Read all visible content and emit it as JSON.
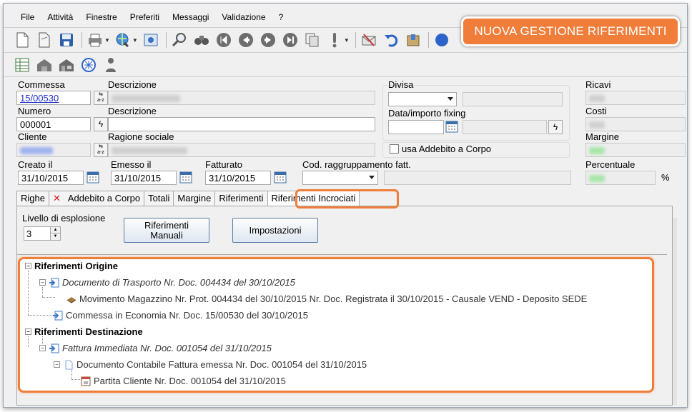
{
  "menu": [
    "File",
    "Attività",
    "Finestre",
    "Preferiti",
    "Messaggi",
    "Validazione",
    "?"
  ],
  "banner": "NUOVA GESTIONE RIFERIMENTI",
  "form": {
    "commessa_label": "Commessa",
    "commessa_value": "15/00530",
    "descrizione_label": "Descrizione",
    "numero_label": "Numero",
    "numero_value": "000001",
    "descrizione2_label": "Descrizione",
    "cliente_label": "Cliente",
    "ragione_sociale_label": "Ragione sociale",
    "divisa_label": "Divisa",
    "fixing_label": "Data/importo fixing",
    "addebito_label": "usa Addebito a Corpo",
    "ricavi_label": "Ricavi",
    "costi_label": "Costi",
    "margine_label": "Margine",
    "percentuale_label": "Percentuale",
    "percent_sign": "%",
    "creato_label": "Creato il",
    "creato_value": "31/10/2015",
    "emesso_label": "Emesso il",
    "emesso_value": "31/10/2015",
    "fatturato_label": "Fatturato",
    "fatturato_value": "31/10/2015",
    "cod_label": "Cod. raggruppamento fatt.",
    "lookup_icon_text": "a-z"
  },
  "tabs": [
    "Righe",
    "Addebito a Corpo",
    "Totali",
    "Margine",
    "Riferimenti",
    "Riferimenti Incrociati"
  ],
  "panel": {
    "livello_label": "Livello di esplosione",
    "livello_value": "3",
    "btn_manuali": "Riferimenti\nManuali",
    "btn_impostazioni": "Impostazioni"
  },
  "tree": {
    "origine": "Riferimenti Origine",
    "ddt": "Documento di Trasporto Nr. Doc. 004434 del 30/10/2015",
    "movimento": "Movimento Magazzino Nr. Prot. 004434 del 30/10/2015 Nr. Doc.  Registrata il 30/10/2015  - Causale VEND - Deposito SEDE",
    "commessa": "Commessa in Economia Nr. Doc. 15/00530 del 30/10/2015",
    "destinazione": "Riferimenti Destinazione",
    "fattura": "Fattura Immediata Nr. Doc. 001054 del 31/10/2015",
    "contabile": "Documento Contabile Fattura emessa Nr. Doc. 001054 del 31/10/2015",
    "partita": "Partita Cliente Nr. Doc. 001054 del 31/10/2015"
  },
  "colors": {
    "accent": "#f07d3a",
    "link": "#2233cc"
  }
}
